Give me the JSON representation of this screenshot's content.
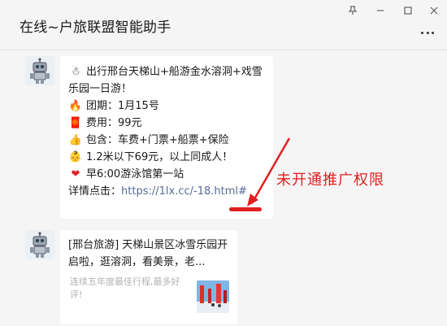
{
  "window": {
    "title": "在线~户旅联盟智能助手",
    "controls": [
      "pin-icon",
      "minimize-icon",
      "maximize-icon",
      "close-icon"
    ],
    "more_icon": "more-dots-icon"
  },
  "messages": [
    {
      "avatar": "robot-avatar",
      "lines": [
        {
          "icon": "snowman-emoji",
          "glyph": "☃",
          "text": "出行邢台天梯山+船游金水溶洞+戏雪乐园一日游！"
        },
        {
          "icon": "fire-emoji",
          "glyph": "🔥",
          "text": "团期：1月15号"
        },
        {
          "icon": "red-envelope-emoji",
          "glyph": "🧧",
          "text": "费用：99元"
        },
        {
          "icon": "thumbs-up-emoji",
          "glyph": "👍",
          "text": "包含：车费+门票+船票+保险"
        },
        {
          "icon": "child-face-emoji",
          "glyph": "👶",
          "text": "1.2米以下69元，以上同成人！"
        },
        {
          "icon": "heart-emoji",
          "glyph": "❤",
          "text": "早6:00游泳馆第一站"
        }
      ],
      "link_prefix": "详情点击：",
      "link_text": "https://1lx.cc/-18.html#"
    },
    {
      "avatar": "robot-avatar",
      "card_title": "[邢台旅游] 天梯山景区冰雪乐园开启啦，逛溶洞，看美景，老...",
      "card_desc": "连续五年度最佳行程,最多好评!",
      "thumbnail": "scenic-thumbnail"
    }
  ],
  "annotation": {
    "text": "未开通推广权限",
    "color": "#e02020"
  },
  "colors": {
    "background": "#f5f5f5",
    "bubble": "#ffffff",
    "link": "#576b95",
    "annotation": "#e02020"
  }
}
